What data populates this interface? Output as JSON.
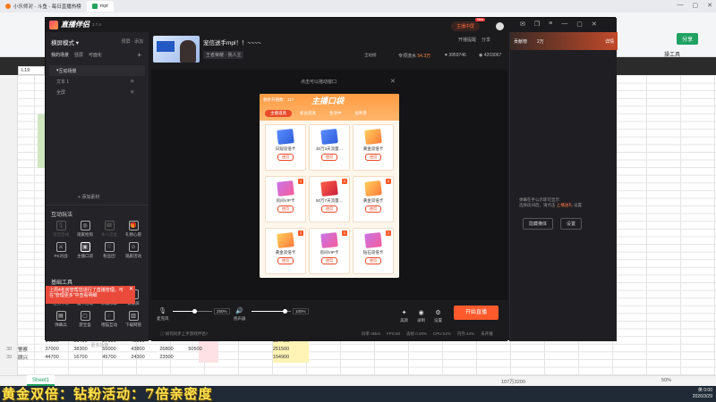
{
  "browser": {
    "tabs": [
      {
        "label": "小乐师对 - 斗鱼 - 每日直播热榜",
        "active": false
      },
      {
        "label": "mpl",
        "active": true
      }
    ]
  },
  "sheet": {
    "cell_ref": "L19",
    "share_label": "分享",
    "tools_label": "操工具",
    "rows": [
      {
        "num": "",
        "name": "",
        "cells": [
          "14000",
          "31400",
          "27100",
          "40000",
          "",
          "",
          "",
          "",
          "154400"
        ]
      },
      {
        "num": "38",
        "name": "警察",
        "cells": [
          "37000",
          "38300",
          "55000",
          "43800",
          "26800",
          "50500",
          "",
          "",
          "251500"
        ]
      },
      {
        "num": "39",
        "name": "顾兴",
        "cells": [
          "44700",
          "16700",
          "45700",
          "24300",
          "23500",
          "",
          "",
          "",
          "154900"
        ]
      }
    ],
    "tab_name": "Sheet1",
    "status": "107万3200",
    "zoom": "50%"
  },
  "taskbar": {
    "marquee": "黄金双倍：钻粉活动：7倍亲密度",
    "time": "0:00",
    "date": "2026/3/29",
    "lang": "英"
  },
  "app": {
    "name": "直播伴侣",
    "version": "3.7.4",
    "left": {
      "mode_label": "横屏模式",
      "mode_right": "预屏 · 添加",
      "sub_tabs": [
        "我的场景",
        "竖屏",
        "可面化"
      ],
      "scenes": [
        {
          "label": "互动场景",
          "group": true
        },
        {
          "label": "文本 1",
          "group": false
        },
        {
          "label": "全屏",
          "group": false
        }
      ],
      "add_material": "+ 添加素材",
      "interact_title": "互动玩法",
      "interact_tools": [
        {
          "label": "语音连线",
          "icon": "🎙",
          "disabled": true,
          "active": false
        },
        {
          "label": "观家抢购",
          "icon": "◎",
          "disabled": false,
          "active": false
        },
        {
          "label": "本人连麦",
          "icon": "☎",
          "disabled": true,
          "active": false
        },
        {
          "label": "礼物心愿",
          "icon": "🎁",
          "disabled": false,
          "active": false
        },
        {
          "label": "PK对战",
          "icon": "⚔",
          "disabled": false,
          "active": false
        },
        {
          "label": "主播口袋",
          "icon": "▣",
          "disabled": false,
          "active": true
        },
        {
          "label": "粉丝团",
          "icon": "♡",
          "disabled": false,
          "active": false
        },
        {
          "label": "观剧活动",
          "icon": "☺",
          "disabled": false,
          "active": false
        }
      ],
      "basic_title": "基础工具",
      "basic_tools": [
        {
          "label": "任务中心",
          "icon": "☑"
        },
        {
          "label": "魔卡活动",
          "icon": "▦"
        },
        {
          "label": "添加绿幕",
          "icon": "▭"
        },
        {
          "label": "云录屏",
          "icon": "⬇"
        },
        {
          "label": "弹幕兵",
          "icon": "▤"
        },
        {
          "label": "游宝盒",
          "icon": "▢"
        },
        {
          "label": "喂猫互动",
          "icon": "◌"
        },
        {
          "label": "下载网管",
          "icon": "▥"
        }
      ],
      "more": "··· 更多功能",
      "tip": "上周4名房管帮您进行了直播管理。可在\"管理更多\"中查看明细"
    },
    "stream": {
      "title": "宠信送手mpl！！~~~~",
      "tag": "王者荣耀 · 我人主",
      "tag2": "全站榜",
      "stats": [
        {
          "label": "专项流水",
          "value": "54.3万"
        },
        {
          "label": "",
          "value": "3959746"
        },
        {
          "label": "",
          "value": "4203067"
        }
      ]
    },
    "header": {
      "main_screen": "主播中屏",
      "new_badge": "New",
      "help_links": [
        "开播提醒",
        "分享"
      ]
    },
    "right": {
      "count": "贡献榜",
      "range": "2万",
      "more": "详情",
      "hint_line1": "弹幕在手公示即可显示",
      "hint_line2": "选择房间后，请点击",
      "hint_link": "上播送礼",
      "hint_tail": "设置",
      "buttons": [
        "隐藏横体",
        "设置"
      ]
    },
    "preview": {
      "drag_hint": "点击可以拖动窗口",
      "pocket": {
        "count_text": "剩余开播数：117",
        "title": "主播口袋",
        "tabs": [
          {
            "label": "主播道具",
            "active": true
          },
          {
            "label": "权益道具",
            "active": false
          },
          {
            "label": "生效中",
            "active": false
          },
          {
            "label": "福利券",
            "active": false
          }
        ],
        "cards": [
          {
            "name": "日观双倍卡",
            "kind": "blue",
            "badge": "",
            "btn": "使用"
          },
          {
            "name": "30万3天流量…",
            "kind": "blue",
            "badge": "",
            "btn": "使用"
          },
          {
            "name": "黄金双倍卡",
            "kind": "gold",
            "badge": "",
            "btn": "使用"
          },
          {
            "name": "房间VIP卡",
            "kind": "vip",
            "badge": "1",
            "btn": "使用"
          },
          {
            "name": "50万7天流量…",
            "kind": "red",
            "badge": "1",
            "btn": "使用"
          },
          {
            "name": "黄金双倍卡",
            "kind": "gold",
            "badge": "1",
            "btn": "使用"
          },
          {
            "name": "黄金双倍卡",
            "kind": "gold",
            "badge": "1",
            "btn": "使用"
          },
          {
            "name": "房间VIP卡",
            "kind": "vip",
            "badge": "1",
            "btn": "使用"
          },
          {
            "name": "钻石双倍卡",
            "kind": "vip",
            "badge": "1",
            "btn": "使用"
          }
        ]
      }
    },
    "bottom": {
      "mic_label": "麦克风",
      "mic_value": "250%",
      "mic_level": 0.55,
      "speaker_label": "扬声器",
      "speaker_value": "100%",
      "speaker_level": 0.85,
      "tools": [
        {
          "label": "美颜",
          "icon": "✦"
        },
        {
          "label": "录制",
          "icon": "◉"
        },
        {
          "label": "设置",
          "icon": "⚙"
        }
      ],
      "start_label": "开始直播",
      "sync_link": "ⓘ 如何同步上手游戏伴侣?",
      "metrics": [
        "码率 0kb/s",
        "FPS:60",
        "丢帧 0.00%",
        "CPU:22%",
        "内存:44%",
        "未开播"
      ]
    }
  }
}
